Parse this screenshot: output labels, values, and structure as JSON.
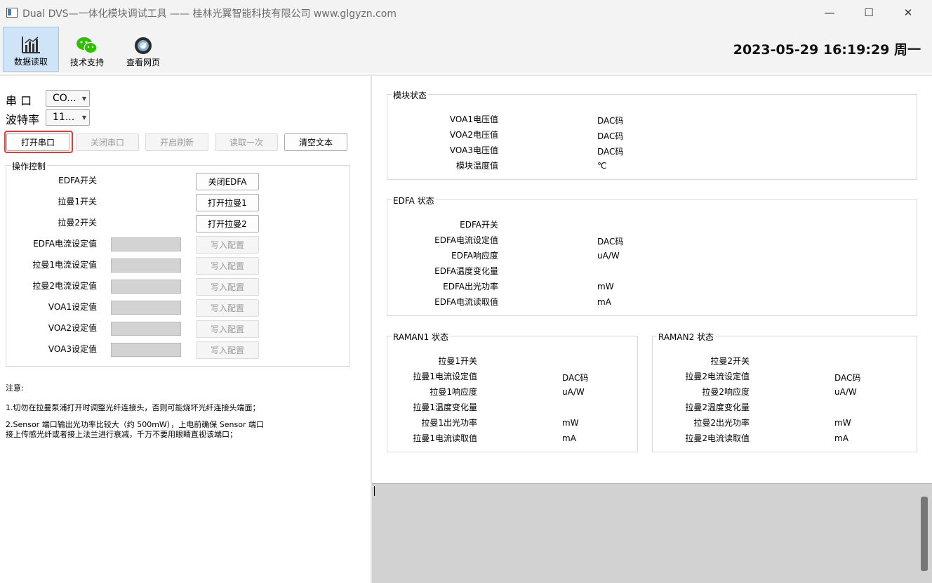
{
  "window": {
    "title": "Dual DVS—一体化模块调试工具 —— 桂林光翼智能科技有限公司 www.glgyzn.com",
    "minimize": "—",
    "maximize": "☐",
    "close": "✕"
  },
  "toolbar": {
    "items": [
      {
        "label": "数据读取",
        "icon": "bar-chart-icon"
      },
      {
        "label": "技术支持",
        "icon": "wechat-icon"
      },
      {
        "label": "查看网页",
        "icon": "browser-icon"
      }
    ],
    "datetime": "2023-05-29 16:19:29 周一"
  },
  "serial": {
    "port_label": "串  口",
    "port_value": "CO...",
    "baud_label": "波特率",
    "baud_value": "11..."
  },
  "actions": {
    "open_port": "打开串口",
    "close_port": "关闭串口",
    "start_refresh": "开启刷新",
    "read_once": "读取一次",
    "clear_text": "清空文本"
  },
  "control": {
    "title": "操作控制",
    "switches": [
      {
        "label": "EDFA开关",
        "button": "关闭EDFA"
      },
      {
        "label": "拉曼1开关",
        "button": "打开拉曼1"
      },
      {
        "label": "拉曼2开关",
        "button": "打开拉曼2"
      }
    ],
    "settings": [
      {
        "label": "EDFA电流设定值",
        "button": "写入配置"
      },
      {
        "label": "拉曼1电流设定值",
        "button": "写入配置"
      },
      {
        "label": "拉曼2电流设定值",
        "button": "写入配置"
      },
      {
        "label": "VOA1设定值",
        "button": "写入配置"
      },
      {
        "label": "VOA2设定值",
        "button": "写入配置"
      },
      {
        "label": "VOA3设定值",
        "button": "写入配置"
      }
    ]
  },
  "notes": {
    "heading": "注意:",
    "line1": "1.切勿在拉曼泵浦打开时调整光纤连接头，否则可能烧坏光纤连接头端面；",
    "line2a": "2.Sensor 端口输出光功率比较大（约 500mW），上电前确保 Sensor 端口",
    "line2b": "接上传感光纤或者接上法兰进行衰减，千万不要用眼睛直视该端口；"
  },
  "module_status": {
    "title": "模块状态",
    "rows": [
      {
        "label": "VOA1电压值",
        "unit": "DAC码"
      },
      {
        "label": "VOA2电压值",
        "unit": "DAC码"
      },
      {
        "label": "VOA3电压值",
        "unit": "DAC码"
      },
      {
        "label": "模块温度值",
        "unit": "℃"
      }
    ]
  },
  "edfa_status": {
    "title": "EDFA 状态",
    "rows": [
      {
        "label": "EDFA开关",
        "unit": ""
      },
      {
        "label": "EDFA电流设定值",
        "unit": "DAC码"
      },
      {
        "label": "EDFA响应度",
        "unit": "uA/W"
      },
      {
        "label": "EDFA温度变化量",
        "unit": ""
      },
      {
        "label": "EDFA出光功率",
        "unit": "mW"
      },
      {
        "label": "EDFA电流读取值",
        "unit": "mA"
      }
    ]
  },
  "raman1_status": {
    "title": "RAMAN1 状态",
    "rows": [
      {
        "label": "拉曼1开关",
        "unit": ""
      },
      {
        "label": "拉曼1电流设定值",
        "unit": "DAC码"
      },
      {
        "label": "拉曼1响应度",
        "unit": "uA/W"
      },
      {
        "label": "拉曼1温度变化量",
        "unit": ""
      },
      {
        "label": "拉曼1出光功率",
        "unit": "mW"
      },
      {
        "label": "拉曼1电流读取值",
        "unit": "mA"
      }
    ]
  },
  "raman2_status": {
    "title": "RAMAN2 状态",
    "rows": [
      {
        "label": "拉曼2开关",
        "unit": ""
      },
      {
        "label": "拉曼2电流设定值",
        "unit": "DAC码"
      },
      {
        "label": "拉曼2响应度",
        "unit": "uA/W"
      },
      {
        "label": "拉曼2温度变化量",
        "unit": ""
      },
      {
        "label": "拉曼2出光功率",
        "unit": "mW"
      },
      {
        "label": "拉曼2电流读取值",
        "unit": "mA"
      }
    ]
  }
}
